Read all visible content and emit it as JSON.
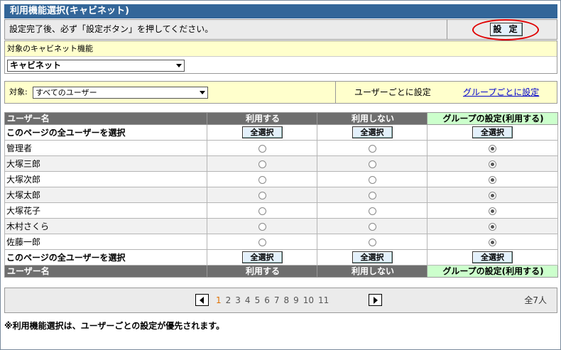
{
  "title": "利用機能選択(キャビネット)",
  "instruction": "設定完了後、必ず「設定ボタン」を押してください。",
  "set_button": "設 定",
  "cabinet": {
    "label": "対象のキャビネット機能",
    "selected": "キャビネット"
  },
  "target": {
    "label": "対象:",
    "selected": "すべてのユーザー",
    "per_user": "ユーザーごとに設定",
    "per_group_link": "グループごとに設定"
  },
  "table": {
    "columns": [
      "ユーザー名",
      "利用する",
      "利用しない",
      "グループの設定(利用する)"
    ],
    "select_all_label": "このページの全ユーザーを選択",
    "select_all_button": "全選択",
    "rows": [
      {
        "name": "管理者",
        "selected": "group"
      },
      {
        "name": "大塚三郎",
        "selected": "group"
      },
      {
        "name": "大塚次郎",
        "selected": "group"
      },
      {
        "name": "大塚太郎",
        "selected": "group"
      },
      {
        "name": "大塚花子",
        "selected": "group"
      },
      {
        "name": "木村さくら",
        "selected": "group"
      },
      {
        "name": "佐藤一郎",
        "selected": "group"
      }
    ]
  },
  "pager": {
    "pages": [
      "1",
      "2",
      "3",
      "4",
      "5",
      "6",
      "7",
      "8",
      "9",
      "10",
      "11"
    ],
    "current": "1",
    "total": "全7人"
  },
  "note": "※利用機能選択は、ユーザーごとの設定が優先されます。",
  "colors": {
    "title_bar": "#336699",
    "highlight_circle": "#e00000",
    "group_header": "#ccffcc",
    "current_page": "#e07000"
  }
}
